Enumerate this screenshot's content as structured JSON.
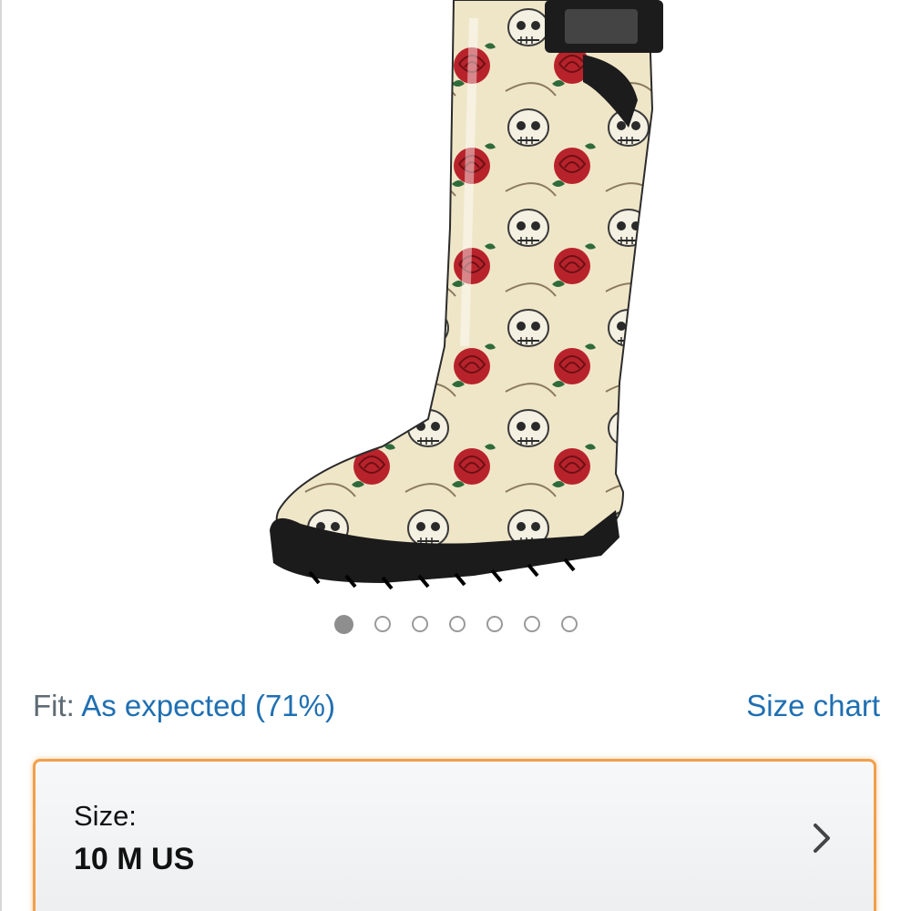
{
  "product": {
    "image_description": "skull-and-roses-rain-boot-icon",
    "carousel": {
      "total": 7,
      "active_index": 0
    }
  },
  "fit": {
    "label": "Fit:",
    "value": "As expected (71%)",
    "size_chart_link": "Size chart"
  },
  "size_selector": {
    "label": "Size:",
    "value": "10 M US",
    "chevron_icon": "chevron-right-icon"
  },
  "colors": {
    "link": "#1f6fb2",
    "highlight_border": "#f0a04b",
    "boot_cream": "#efe6c8",
    "rose_red": "#b8232b",
    "sole_black": "#1b1b1b"
  }
}
